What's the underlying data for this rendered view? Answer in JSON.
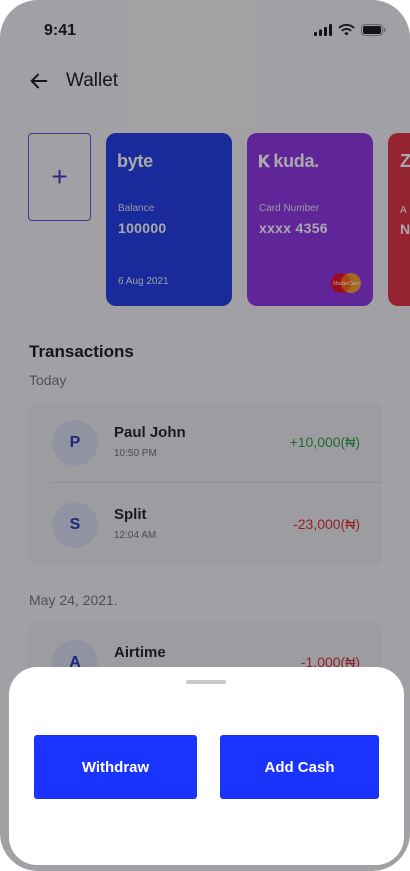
{
  "status_bar": {
    "time": "9:41"
  },
  "header": {
    "title": "Wallet"
  },
  "cards": {
    "add_symbol": "+",
    "items": [
      {
        "brand": "byte",
        "label": "Balance",
        "value": "100000",
        "date": "6 Aug 2021",
        "color": "#1834e6"
      },
      {
        "brand": "kuda.",
        "label": "Card Number",
        "value": "xxxx 4356",
        "network": "MasterCard",
        "color": "#8a2be2"
      },
      {
        "brand": "Z",
        "label": "A",
        "value": "N",
        "color": "#e0283a"
      }
    ]
  },
  "transactions": {
    "title": "Transactions",
    "groups": [
      {
        "label": "Today",
        "items": [
          {
            "initial": "P",
            "name": "Paul John",
            "time": "10:50 PM",
            "amount": "+10,000(₦)",
            "type": "credit"
          },
          {
            "initial": "S",
            "name": "Split",
            "time": "12:04 AM",
            "amount": "-23,000(₦)",
            "type": "debit"
          }
        ]
      },
      {
        "label": "May 24, 2021.",
        "items": [
          {
            "initial": "A",
            "name": "Airtime",
            "amount": "-1,000(₦)",
            "type": "debit"
          }
        ]
      }
    ]
  },
  "sheet": {
    "withdraw_label": "Withdraw",
    "add_cash_label": "Add Cash"
  },
  "colors": {
    "accent": "#1a33ff",
    "credit": "#1f9c3a",
    "debit": "#d7262e"
  }
}
